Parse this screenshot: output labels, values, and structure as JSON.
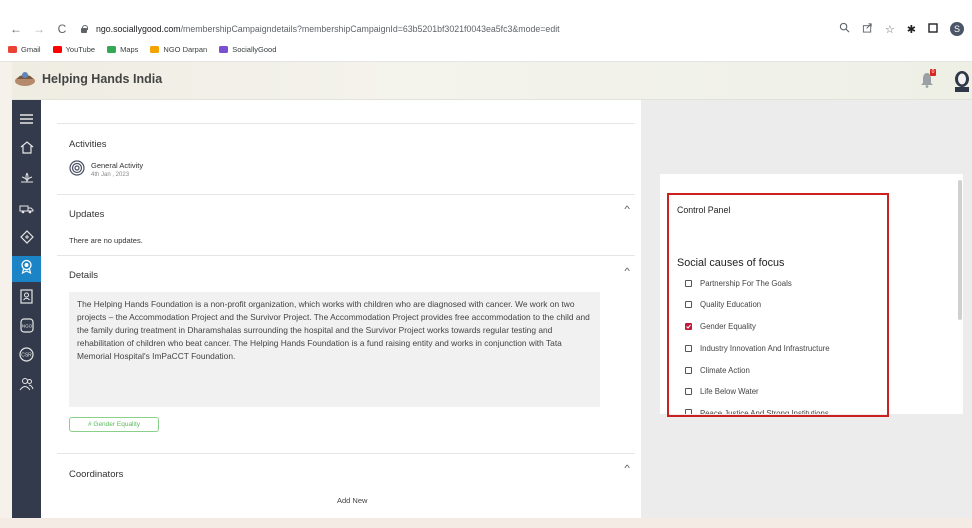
{
  "browser": {
    "url_host": "ngo.sociallygood.com",
    "url_path": "/membershipCampaigndetails?membershipCampaignId=63b5201bf3021f0043ea5fc3&mode=edit",
    "profile_initial": "S",
    "bookmarks": [
      {
        "label": "Gmail",
        "icon": "gmail-icon",
        "color": "#ea4335"
      },
      {
        "label": "YouTube",
        "icon": "youtube-icon",
        "color": "#ff0000"
      },
      {
        "label": "Maps",
        "icon": "maps-icon",
        "color": "#34a853"
      },
      {
        "label": "NGO Darpan",
        "icon": "ngo-darpan-icon",
        "color": "#f4a300"
      },
      {
        "label": "SociallyGood",
        "icon": "sociallygood-icon",
        "color": "#7b4fd1"
      }
    ]
  },
  "header": {
    "title": "Helping Hands India",
    "notification_count": "0"
  },
  "sidebar": {
    "items": [
      {
        "icon": "menu-icon",
        "active": false
      },
      {
        "icon": "home-icon",
        "active": false
      },
      {
        "icon": "lotus-icon",
        "active": false
      },
      {
        "icon": "donation-truck-icon",
        "active": false
      },
      {
        "icon": "diamond-sign-icon",
        "active": false
      },
      {
        "icon": "badge-icon",
        "active": true
      },
      {
        "icon": "id-card-icon",
        "active": false
      },
      {
        "icon": "ngo-icon",
        "active": false
      },
      {
        "icon": "csr-icon",
        "active": false
      },
      {
        "icon": "people-icon",
        "active": false
      }
    ],
    "accent": "#1b84c6"
  },
  "main": {
    "activities": {
      "title": "Activities",
      "items": [
        {
          "name": "General Activity",
          "date": "4th Jan , 2023"
        }
      ]
    },
    "updates": {
      "title": "Updates",
      "empty_text": "There are no updates."
    },
    "details": {
      "title": "Details",
      "text": "The Helping Hands Foundation is a non-profit organization, which works with children who are diagnosed with cancer. We work on two projects – the Accommodation Project and the Survivor Project. The Accommodation Project provides free accommodation to the child and the family during treatment in Dharamshalas surrounding the hospital and the Survivor Project works towards regular testing and rehabilitation of children who beat cancer. The Helping Hands Foundation is a fund raising entity and works in conjunction with Tata Memorial Hospital's ImPaCCT Foundation.",
      "tag": "# Gender Equality"
    },
    "coordinators": {
      "title": "Coordinators",
      "add_new": "Add New"
    }
  },
  "control_panel": {
    "title": "Control Panel",
    "causes_title": "Social causes of focus",
    "causes": [
      {
        "label": "Partnership For The Goals",
        "checked": false
      },
      {
        "label": "Quality Education",
        "checked": false
      },
      {
        "label": "Gender Equality",
        "checked": true
      },
      {
        "label": "Industry Innovation And Infrastructure",
        "checked": false
      },
      {
        "label": "Climate Action",
        "checked": false
      },
      {
        "label": "Life Below Water",
        "checked": false
      },
      {
        "label": "Peace Justice And Strong Institutions",
        "checked": false
      }
    ],
    "highlight_color": "#cc1f1f",
    "check_color": "#c2183a"
  }
}
